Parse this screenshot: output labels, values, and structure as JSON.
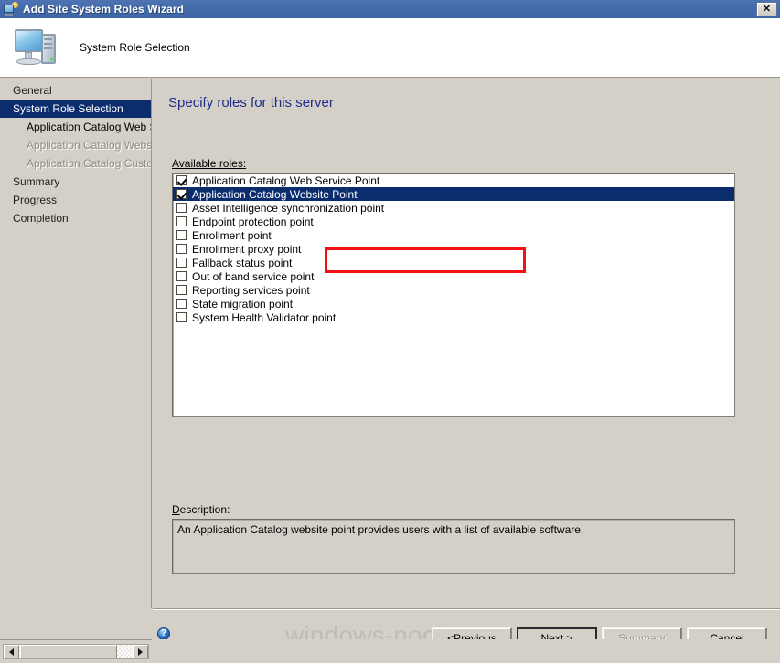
{
  "window": {
    "title": "Add Site System Roles Wizard",
    "title_icon": "site-system-wizard-icon",
    "close_label": "✕"
  },
  "header": {
    "icon": "computer-icon",
    "title": "System Role Selection"
  },
  "sidebar": {
    "items": [
      {
        "label": "General",
        "state": "normal",
        "level": 0
      },
      {
        "label": "System Role Selection",
        "state": "selected",
        "level": 0
      },
      {
        "label": "Application Catalog Web Se",
        "state": "active",
        "level": 1
      },
      {
        "label": "Application Catalog Website",
        "state": "disabled",
        "level": 1
      },
      {
        "label": "Application Catalog Customi",
        "state": "disabled",
        "level": 1
      },
      {
        "label": "Summary",
        "state": "normal",
        "level": 0
      },
      {
        "label": "Progress",
        "state": "normal",
        "level": 0
      },
      {
        "label": "Completion",
        "state": "normal",
        "level": 0
      }
    ]
  },
  "main": {
    "page_title": "Specify roles for this server",
    "available_roles_label": "Available roles:",
    "description_label_prefix": "D",
    "description_label_rest": "escription:",
    "roles": [
      {
        "label": "Application Catalog Web Service Point",
        "checked": true,
        "selected": false
      },
      {
        "label": "Application Catalog Website Point",
        "checked": true,
        "selected": true
      },
      {
        "label": "Asset Intelligence synchronization point",
        "checked": false,
        "selected": false
      },
      {
        "label": "Endpoint protection point",
        "checked": false,
        "selected": false
      },
      {
        "label": "Enrollment point",
        "checked": false,
        "selected": false
      },
      {
        "label": "Enrollment proxy point",
        "checked": false,
        "selected": false
      },
      {
        "label": "Fallback status point",
        "checked": false,
        "selected": false
      },
      {
        "label": "Out of band service point",
        "checked": false,
        "selected": false
      },
      {
        "label": "Reporting services point",
        "checked": false,
        "selected": false
      },
      {
        "label": "State migration point",
        "checked": false,
        "selected": false
      },
      {
        "label": "System Health Validator point",
        "checked": false,
        "selected": false
      }
    ],
    "description_text": "An Application Catalog website point provides users with a list of available software."
  },
  "annotation": {
    "type": "red-rectangle-highlight",
    "color": "#f40f13",
    "encloses": "Application Catalog Web Service Point and Application Catalog Website Point rows"
  },
  "footer": {
    "help_icon": "help-icon",
    "help_glyph": "?",
    "watermark": "windows-noob.com",
    "buttons": [
      {
        "name": "previous",
        "prefix": "< ",
        "accel": "P",
        "rest": "revious",
        "state": "enabled"
      },
      {
        "name": "next",
        "prefix": "",
        "accel": "N",
        "rest": "ext >",
        "state": "default"
      },
      {
        "name": "summary",
        "prefix": "",
        "accel": "S",
        "rest": "ummary",
        "state": "disabled"
      },
      {
        "name": "cancel",
        "prefix": "",
        "accel": "",
        "rest": "Cancel",
        "state": "enabled"
      }
    ]
  },
  "scrollbar": {
    "left_arrow": "◀",
    "right_arrow": "▶"
  }
}
